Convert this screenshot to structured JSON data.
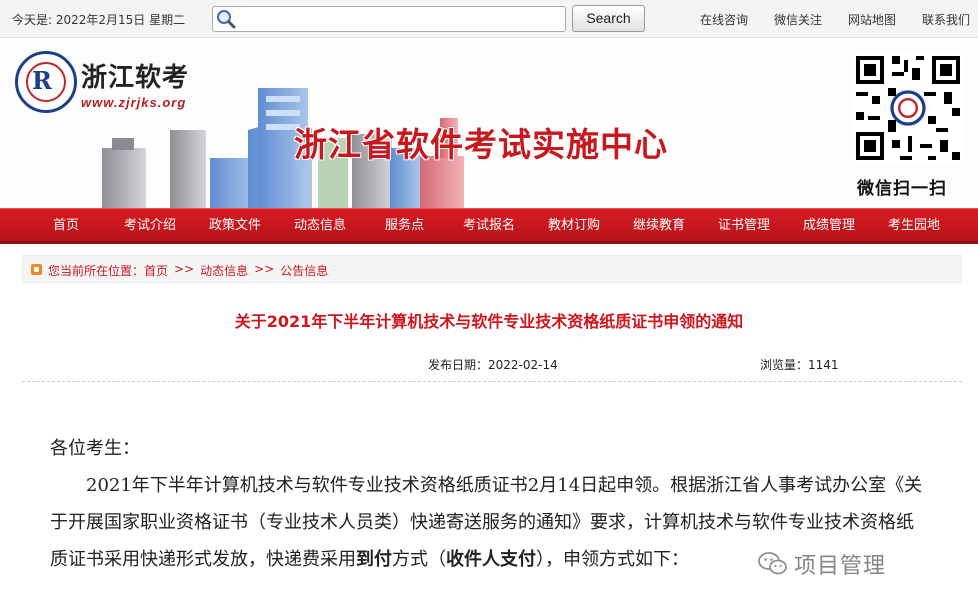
{
  "topbar": {
    "date_text": "今天是:  2022年2月15日  星期二",
    "search_placeholder": "",
    "search_button": "Search",
    "links": [
      "在线咨询",
      "微信关注",
      "网站地图",
      "联系我们"
    ]
  },
  "header": {
    "logo_name": "浙江软考",
    "logo_url": "www.zjrjks.org",
    "site_title": "浙江省软件考试实施中心",
    "qr_caption": "微信扫一扫"
  },
  "nav": {
    "items": [
      "首页",
      "考试介绍",
      "政策文件",
      "动态信息",
      "服务点",
      "考试报名",
      "教材订购",
      "继续教育",
      "证书管理",
      "成绩管理",
      "考生园地"
    ]
  },
  "breadcrumb": {
    "prefix": "您当前所在位置：",
    "parts": [
      "首页",
      ">>",
      "动态信息",
      ">>",
      "公告信息"
    ]
  },
  "article": {
    "title": "关于2021年下半年计算机技术与软件专业技术资格纸质证书申领的通知",
    "publish_label": "发布日期：2022-02-14",
    "views_label": "浏览量：1141",
    "salutation": "各位考生：",
    "para1_a": "2021年下半年计算机技术与软件专业技术资格纸质证书2月14日起申领。根据浙江省人事考试办公室《关于开展国家职业资格证书（专业技术人员类）快递寄送服务的通知》要求，计算机技术与软件专业技术资格纸质证书采用快递形式发放，快递费采用",
    "para1_bold1": "到付",
    "para1_b": "方式（",
    "para1_bold2": "收件人支付",
    "para1_c": "），申领方式如下："
  },
  "watermark": {
    "text": "项目管理"
  },
  "colors": {
    "brand_red": "#c8181e",
    "nav_red": "#d71c22",
    "crumb_icon": "#f08a1e"
  }
}
